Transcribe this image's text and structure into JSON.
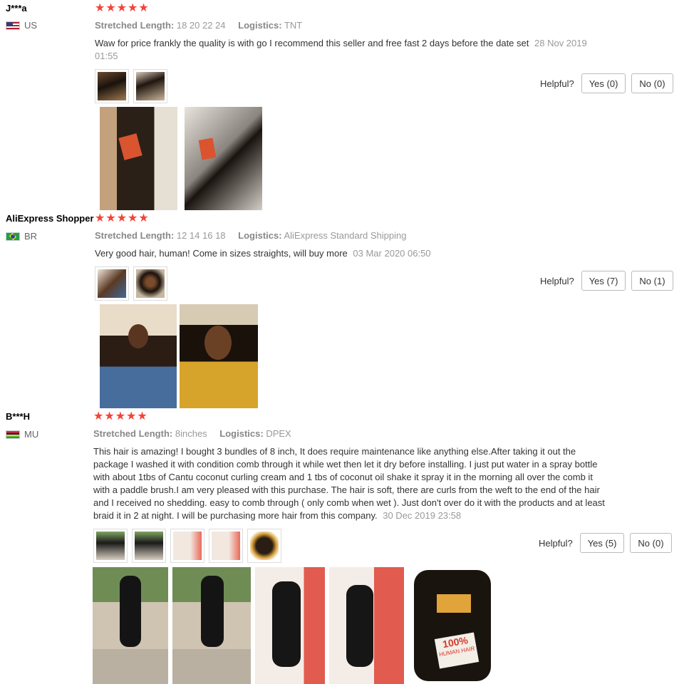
{
  "reviews": [
    {
      "user": "J***a",
      "country": "US",
      "stars": [
        "★",
        "★",
        "★",
        "★",
        "★"
      ],
      "stretched_label": "Stretched Length:",
      "stretched_value": "18 20 22 24",
      "logistics_label": "Logistics:",
      "logistics_value": "TNT",
      "text": "Waw for price frankly the quality is with go I recommend this seller and free fast 2 days before the date set",
      "date": "28 Nov 2019 01:55",
      "helpful_label": "Helpful?",
      "yes_label": "Yes (0)",
      "no_label": "No (0)"
    },
    {
      "user": "AliExpress Shopper",
      "country": "BR",
      "stars": [
        "★",
        "★",
        "★",
        "★",
        "★"
      ],
      "stretched_label": "Stretched Length:",
      "stretched_value": "12 14 16 18",
      "logistics_label": "Logistics:",
      "logistics_value": "AliExpress Standard Shipping",
      "text": "Very good hair, human! Come in sizes straights, will buy more",
      "date": "03 Mar 2020 06:50",
      "helpful_label": "Helpful?",
      "yes_label": "Yes (7)",
      "no_label": "No (1)"
    },
    {
      "user": "B***H",
      "country": "MU",
      "stars": [
        "★",
        "★",
        "★",
        "★",
        "★"
      ],
      "stretched_label": "Stretched Length:",
      "stretched_value": "8inches",
      "logistics_label": "Logistics:",
      "logistics_value": "DPEX",
      "text": "This hair is amazing! I bought 3 bundles of 8 inch, It does require maintenance like anything else.After taking it out the package I washed it with condition comb through it while wet then let it dry before installing. I just put water in a spray bottle with about 1tbs of Cantu coconut curling cream and 1 tbs of coconut oil shake it spray it in the morning all over the comb it with a paddle brush.I am very pleased with this purchase. The hair is soft, there are curls from the weft to the end of the hair and I received no shedding. easy to comb through ( only comb when wet ). Just don't over do it with the products and at least braid it in 2 at night. I will be purchasing more hair from this company.",
      "date": "30 Dec 2019 23:58",
      "helpful_label": "Helpful?",
      "yes_label": "Yes (5)",
      "no_label": "No (0)",
      "photo_label_line1": "100%",
      "photo_label_line2": "HUMAN HAIR"
    }
  ]
}
